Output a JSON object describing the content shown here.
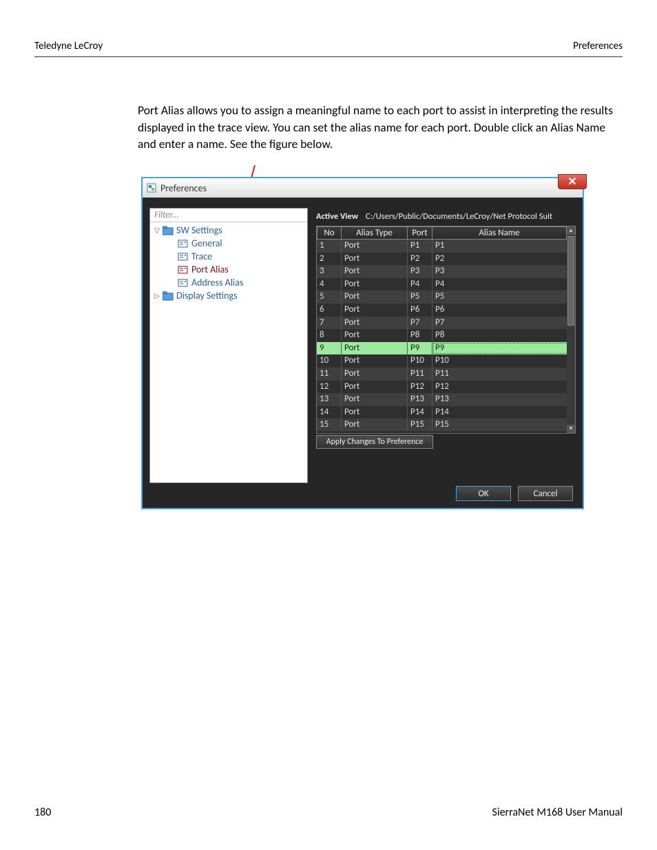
{
  "header": {
    "left": "Teledyne LeCroy",
    "right": "Preferences"
  },
  "body_paragraph": "Port Alias allows you to assign a meaningful name to each port to assist in interpreting the results displayed in the trace view. You can set the alias name for each port. Double click an Alias Name and enter a name. See the figure below.",
  "footer": {
    "left": "180",
    "right": "SierraNet M168 User Manual"
  },
  "dialog": {
    "title": "Preferences",
    "filter_placeholder": "Filter...",
    "tree": {
      "sw_settings": "SW Settings",
      "general": "General",
      "trace": "Trace",
      "port_alias": "Port Alias",
      "address_alias": "Address Alias",
      "display_settings": "Display Settings"
    },
    "active_view_label": "Active View",
    "active_view_path": "C:/Users/Public/Documents/LeCroy/Net Protocol Suit",
    "columns": {
      "no": "No",
      "alias_type": "Alias Type",
      "port": "Port",
      "alias_name": "Alias Name"
    },
    "rows": [
      {
        "no": "1",
        "type": "Port",
        "port": "P1",
        "alias": "P1"
      },
      {
        "no": "2",
        "type": "Port",
        "port": "P2",
        "alias": "P2"
      },
      {
        "no": "3",
        "type": "Port",
        "port": "P3",
        "alias": "P3"
      },
      {
        "no": "4",
        "type": "Port",
        "port": "P4",
        "alias": "P4"
      },
      {
        "no": "5",
        "type": "Port",
        "port": "P5",
        "alias": "P5"
      },
      {
        "no": "6",
        "type": "Port",
        "port": "P6",
        "alias": "P6"
      },
      {
        "no": "7",
        "type": "Port",
        "port": "P7",
        "alias": "P7"
      },
      {
        "no": "8",
        "type": "Port",
        "port": "P8",
        "alias": "P8"
      },
      {
        "no": "9",
        "type": "Port",
        "port": "P9",
        "alias": "P9"
      },
      {
        "no": "10",
        "type": "Port",
        "port": "P10",
        "alias": "P10"
      },
      {
        "no": "11",
        "type": "Port",
        "port": "P11",
        "alias": "P11"
      },
      {
        "no": "12",
        "type": "Port",
        "port": "P12",
        "alias": "P12"
      },
      {
        "no": "13",
        "type": "Port",
        "port": "P13",
        "alias": "P13"
      },
      {
        "no": "14",
        "type": "Port",
        "port": "P14",
        "alias": "P14"
      },
      {
        "no": "15",
        "type": "Port",
        "port": "P15",
        "alias": "P15"
      }
    ],
    "selected_row_index": 8,
    "apply_button": "Apply Changes To Preference",
    "ok": "OK",
    "cancel": "Cancel"
  }
}
